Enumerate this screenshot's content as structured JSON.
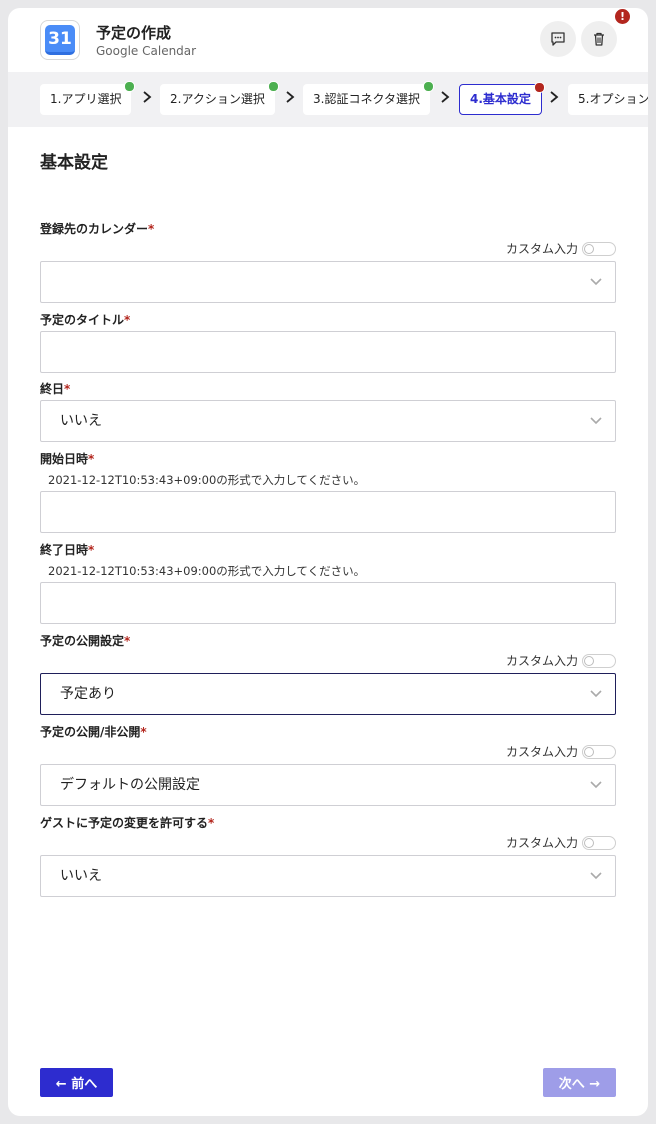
{
  "header": {
    "title": "予定の作成",
    "subtitle": "Google Calendar",
    "app_icon_text": "31",
    "alert_badge": "!"
  },
  "steps": [
    {
      "label": "1.アプリ選択",
      "status": "done"
    },
    {
      "label": "2.アクション選択",
      "status": "done"
    },
    {
      "label": "3.認証コネクタ選択",
      "status": "done"
    },
    {
      "label": "4.基本設定",
      "status": "error",
      "active": true
    },
    {
      "label": "5.オプション",
      "status": "none"
    }
  ],
  "section_title": "基本設定",
  "required_mark": "*",
  "custom_input_label": "カスタム入力",
  "fields": {
    "calendar": {
      "label": "登録先のカレンダー",
      "value": ""
    },
    "title": {
      "label": "予定のタイトル",
      "value": ""
    },
    "all_day": {
      "label": "終日",
      "value": "いいえ"
    },
    "start": {
      "label": "開始日時",
      "hint": "2021-12-12T10:53:43+09:00の形式で入力してください。",
      "value": ""
    },
    "end": {
      "label": "終了日時",
      "hint": "2021-12-12T10:53:43+09:00の形式で入力してください。",
      "value": ""
    },
    "publish_setting": {
      "label": "予定の公開設定",
      "value": "予定あり"
    },
    "visibility": {
      "label": "予定の公開/非公開",
      "value": "デフォルトの公開設定"
    },
    "guest_modify": {
      "label": "ゲストに予定の変更を許可する",
      "value": "いいえ"
    }
  },
  "nav": {
    "prev": "← 前へ",
    "next": "次へ →"
  },
  "colors": {
    "primary": "#2d2ccf",
    "primary_disabled": "#9e9de8",
    "required": "#b3261e",
    "done": "#4caf50"
  }
}
